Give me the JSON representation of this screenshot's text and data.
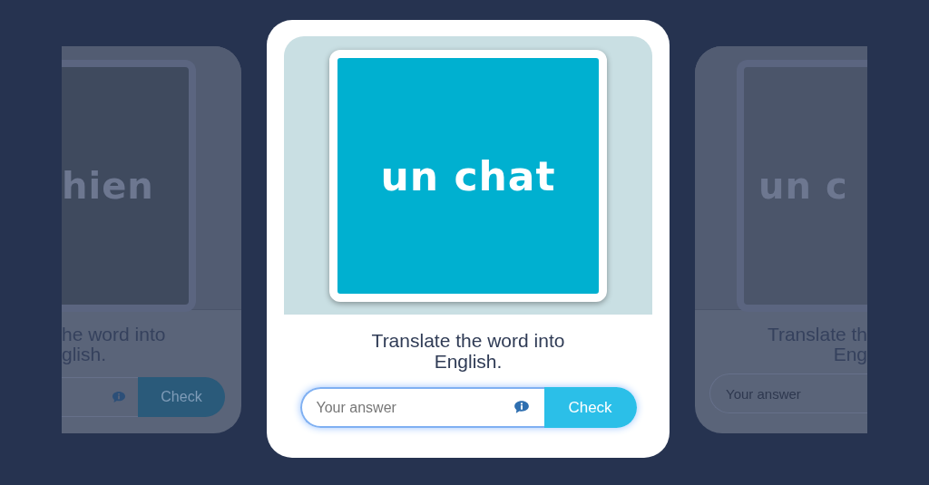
{
  "cards": [
    {
      "kind": "left-peek",
      "word": "hien",
      "prompt_lines": [
        "he word into",
        "glish."
      ],
      "button": "Check"
    },
    {
      "kind": "active",
      "word": "un chat",
      "prompt_lines": [
        "Translate the word into",
        "English."
      ],
      "placeholder": "Your answer",
      "focused": true,
      "button": "Check"
    },
    {
      "kind": "right-peek",
      "word": "un c",
      "prompt_lines": [
        "Translate th",
        "Eng"
      ],
      "placeholder": "Your answer"
    }
  ]
}
